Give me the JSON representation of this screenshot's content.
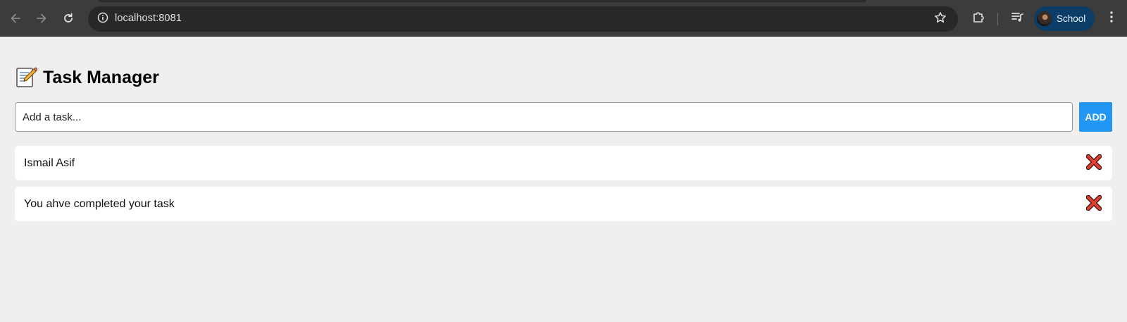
{
  "browser": {
    "url": "localhost:8081",
    "profile_label": "School",
    "icons": {
      "back": "back-arrow-icon",
      "forward": "forward-arrow-icon",
      "reload": "reload-icon",
      "site_info": "info-icon",
      "bookmark": "star-icon",
      "extensions": "puzzle-icon",
      "media": "queue-music-icon",
      "menu": "kebab-menu-icon"
    },
    "colors": {
      "toolbar": "#3c3c3c",
      "omnibox": "#282828",
      "profile_chip": "#0b3d66"
    }
  },
  "app": {
    "title": "Task Manager",
    "title_icon": "memo-icon",
    "input": {
      "placeholder": "Add a task...",
      "value": ""
    },
    "add_label": "ADD",
    "accent_color": "#2196f3",
    "tasks": [
      {
        "text": "Ismail Asif",
        "delete_icon": "cross-mark-icon"
      },
      {
        "text": "You ahve completed your task",
        "delete_icon": "cross-mark-icon"
      }
    ]
  }
}
